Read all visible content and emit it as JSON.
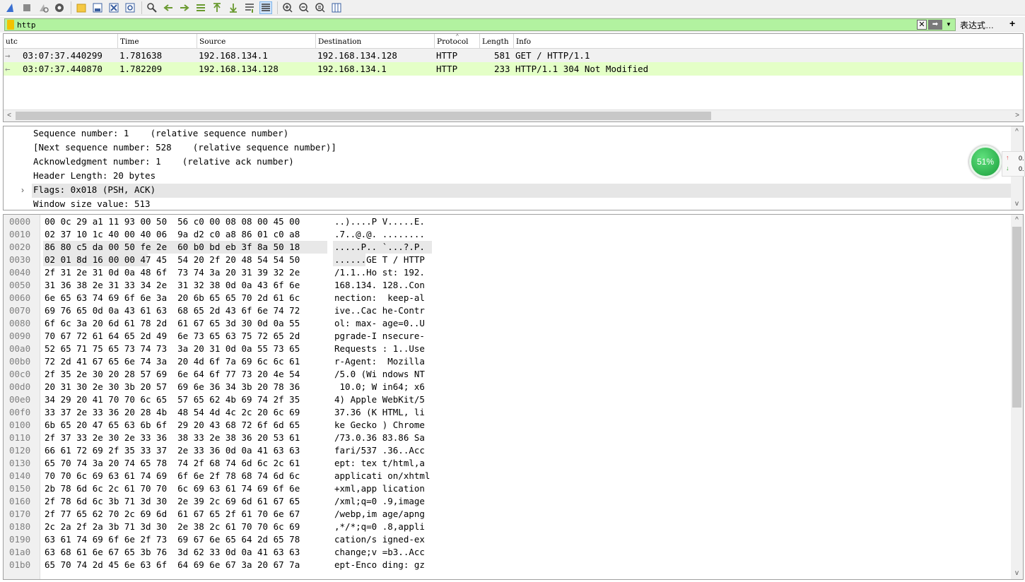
{
  "toolbar": {
    "icons": [
      "shark-fin-start-icon",
      "stop-square-icon",
      "restart-icon",
      "capture-options-gear-icon",
      "open-folder-icon",
      "save-file-icon",
      "close-file-icon",
      "reload-file-icon",
      "find-packet-icon",
      "go-back-icon",
      "go-forward-icon",
      "go-to-packet-icon",
      "go-first-icon",
      "go-last-icon",
      "auto-scroll-icon",
      "colorize-icon",
      "zoom-in-icon",
      "zoom-out-icon",
      "normal-size-icon",
      "resize-columns-icon"
    ]
  },
  "filter": {
    "value": "http",
    "expression_label": "表达式…",
    "plus_label": "+"
  },
  "packet_list": {
    "columns": [
      "utc",
      "Time",
      "Source",
      "Destination",
      "Protocol",
      "Length",
      "Info"
    ],
    "rows": [
      {
        "utc": "03:07:37.440299",
        "time": "1.781638",
        "source": "192.168.134.1",
        "destination": "192.168.134.128",
        "protocol": "HTTP",
        "length": "581",
        "info": "GET / HTTP/1.1"
      },
      {
        "utc": "03:07:37.440870",
        "time": "1.782209",
        "source": "192.168.134.128",
        "destination": "192.168.134.1",
        "protocol": "HTTP",
        "length": "233",
        "info": "HTTP/1.1 304 Not Modified"
      }
    ]
  },
  "details": {
    "lines": [
      "Sequence number: 1    (relative sequence number)",
      "[Next sequence number: 528    (relative sequence number)]",
      "Acknowledgment number: 1    (relative ack number)",
      "Header Length: 20 bytes",
      "Flags: 0x018 (PSH, ACK)",
      "Window size value: 513"
    ]
  },
  "badge": {
    "percent": "51%",
    "up_value": "0.",
    "down_value": "0."
  },
  "bytes": {
    "offsets": [
      "0000",
      "0010",
      "0020",
      "0030",
      "0040",
      "0050",
      "0060",
      "0070",
      "0080",
      "0090",
      "00a0",
      "00b0",
      "00c0",
      "00d0",
      "00e0",
      "00f0",
      "0100",
      "0110",
      "0120",
      "0130",
      "0140",
      "0150",
      "0160",
      "0170",
      "0180",
      "0190",
      "01a0",
      "01b0"
    ],
    "hex": [
      "00 0c 29 a1 11 93 00 50  56 c0 00 08 08 00 45 00",
      "02 37 10 1c 40 00 40 06  9a d2 c0 a8 86 01 c0 a8",
      "86 80 c5 da 00 50 fe 2e  60 b0 bd eb 3f 8a 50 18",
      "02 01 8d 16 00 00 47 45  54 20 2f 20 48 54 54 50",
      "2f 31 2e 31 0d 0a 48 6f  73 74 3a 20 31 39 32 2e",
      "31 36 38 2e 31 33 34 2e  31 32 38 0d 0a 43 6f 6e",
      "6e 65 63 74 69 6f 6e 3a  20 6b 65 65 70 2d 61 6c",
      "69 76 65 0d 0a 43 61 63  68 65 2d 43 6f 6e 74 72",
      "6f 6c 3a 20 6d 61 78 2d  61 67 65 3d 30 0d 0a 55",
      "70 67 72 61 64 65 2d 49  6e 73 65 63 75 72 65 2d",
      "52 65 71 75 65 73 74 73  3a 20 31 0d 0a 55 73 65",
      "72 2d 41 67 65 6e 74 3a  20 4d 6f 7a 69 6c 6c 61",
      "2f 35 2e 30 20 28 57 69  6e 64 6f 77 73 20 4e 54",
      "20 31 30 2e 30 3b 20 57  69 6e 36 34 3b 20 78 36",
      "34 29 20 41 70 70 6c 65  57 65 62 4b 69 74 2f 35",
      "33 37 2e 33 36 20 28 4b  48 54 4d 4c 2c 20 6c 69",
      "6b 65 20 47 65 63 6b 6f  29 20 43 68 72 6f 6d 65",
      "2f 37 33 2e 30 2e 33 36  38 33 2e 38 36 20 53 61",
      "66 61 72 69 2f 35 33 37  2e 33 36 0d 0a 41 63 63",
      "65 70 74 3a 20 74 65 78  74 2f 68 74 6d 6c 2c 61",
      "70 70 6c 69 63 61 74 69  6f 6e 2f 78 68 74 6d 6c",
      "2b 78 6d 6c 2c 61 70 70  6c 69 63 61 74 69 6f 6e",
      "2f 78 6d 6c 3b 71 3d 30  2e 39 2c 69 6d 61 67 65",
      "2f 77 65 62 70 2c 69 6d  61 67 65 2f 61 70 6e 67",
      "2c 2a 2f 2a 3b 71 3d 30  2e 38 2c 61 70 70 6c 69",
      "63 61 74 69 6f 6e 2f 73  69 67 6e 65 64 2d 65 78",
      "63 68 61 6e 67 65 3b 76  3d 62 33 0d 0a 41 63 63",
      "65 70 74 2d 45 6e 63 6f  64 69 6e 67 3a 20 67 7a"
    ],
    "ascii": [
      "..)....P V.....E.",
      ".7..@.@. ........",
      ".....P.. `...?.P.",
      "......GE T / HTTP",
      "/1.1..Ho st: 192.",
      "168.134. 128..Con",
      "nection:  keep-al",
      "ive..Cac he-Contr",
      "ol: max- age=0..U",
      "pgrade-I nsecure-",
      "Requests : 1..Use",
      "r-Agent:  Mozilla",
      "/5.0 (Wi ndows NT",
      " 10.0; W in64; x6",
      "4) Apple WebKit/5",
      "37.36 (K HTML, li",
      "ke Gecko ) Chrome",
      "/73.0.36 83.86 Sa",
      "fari/537 .36..Acc",
      "ept: tex t/html,a",
      "applicati on/xhtml",
      "+xml,app lication",
      "/xml;q=0 .9,image",
      "/webp,im age/apng",
      ",*/*;q=0 .8,appli",
      "cation/s igned-ex",
      "change;v =b3..Acc",
      "ept-Enco ding: gz"
    ]
  }
}
